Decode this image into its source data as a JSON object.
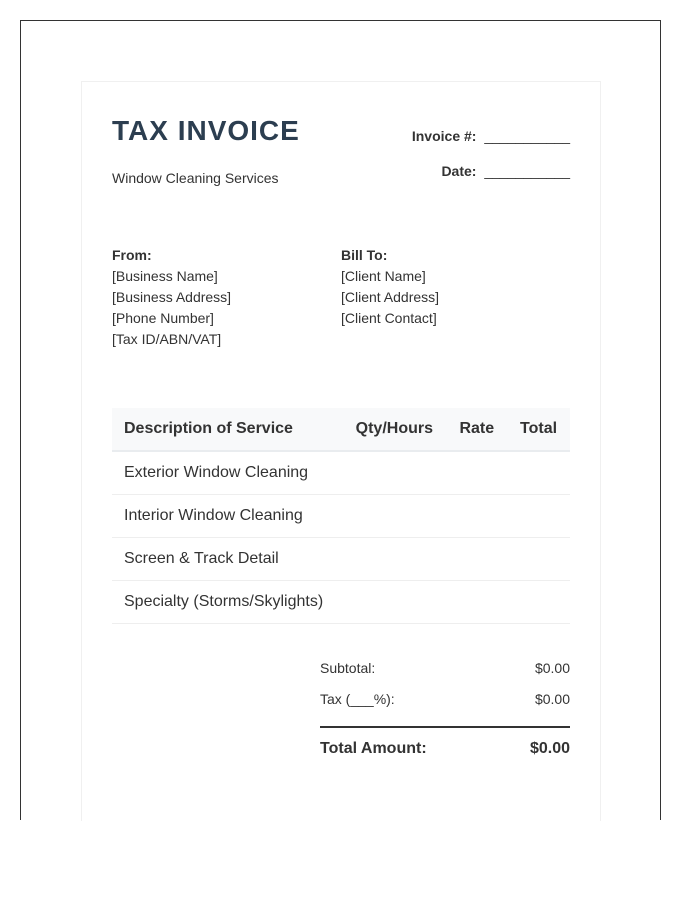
{
  "invoice": {
    "title": "TAX INVOICE",
    "subtitle": "Window Cleaning Services",
    "invoice_number_label": "Invoice #:",
    "invoice_number_value": "___________",
    "date_label": "Date:",
    "date_value": "___________"
  },
  "from": {
    "heading": "From:",
    "lines": [
      "[Business Name]",
      "[Business Address]",
      "[Phone Number]",
      "[Tax ID/ABN/VAT]"
    ]
  },
  "bill_to": {
    "heading": "Bill To:",
    "lines": [
      "[Client Name]",
      "[Client Address]",
      "[Client Contact]"
    ]
  },
  "table": {
    "headers": [
      "Description of Service",
      "Qty/Hours",
      "Rate",
      "Total"
    ],
    "rows": [
      [
        "Exterior Window Cleaning",
        "",
        "",
        ""
      ],
      [
        "Interior Window Cleaning",
        "",
        "",
        ""
      ],
      [
        "Screen & Track Detail",
        "",
        "",
        ""
      ],
      [
        "Specialty (Storms/Skylights)",
        "",
        "",
        ""
      ]
    ]
  },
  "totals": {
    "subtotal_label": "Subtotal:",
    "subtotal_value": "$0.00",
    "tax_label": "Tax (___%):",
    "tax_value": "$0.00",
    "total_label": "Total Amount:",
    "total_value": "$0.00"
  },
  "colors": {
    "title": "#2c3e50",
    "text": "#333333",
    "header_bg": "#f8f9fa"
  }
}
